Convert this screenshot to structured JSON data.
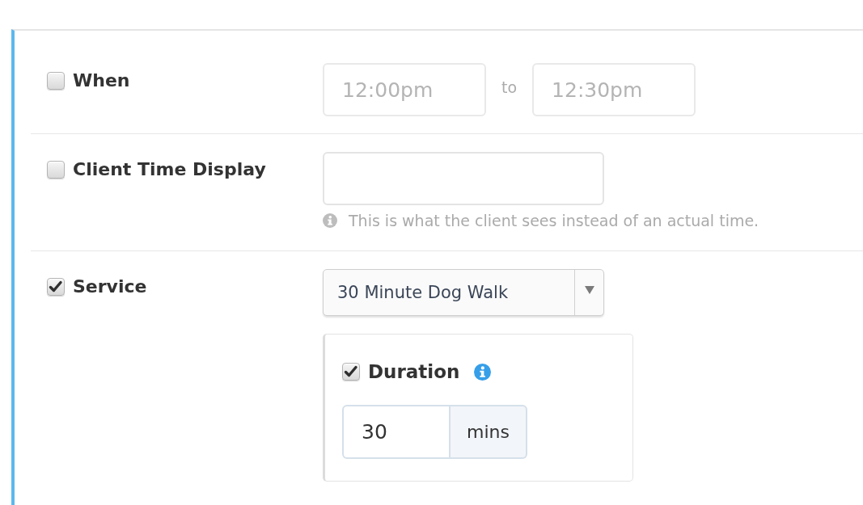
{
  "fields": [
    {
      "kind": "time_range",
      "label": "When",
      "checked": false,
      "start": {
        "placeholder": "12:00pm"
      },
      "separator": "to",
      "end": {
        "placeholder": "12:30pm"
      }
    },
    {
      "kind": "text",
      "label": "Client Time Display",
      "checked": false,
      "help": "This is what the client sees instead of an actual time."
    },
    {
      "kind": "select",
      "label": "Service",
      "checked": true,
      "value": "30 Minute Dog Walk",
      "option": {
        "label": "Duration",
        "checked": true,
        "value": "30",
        "unit": "mins"
      }
    }
  ]
}
